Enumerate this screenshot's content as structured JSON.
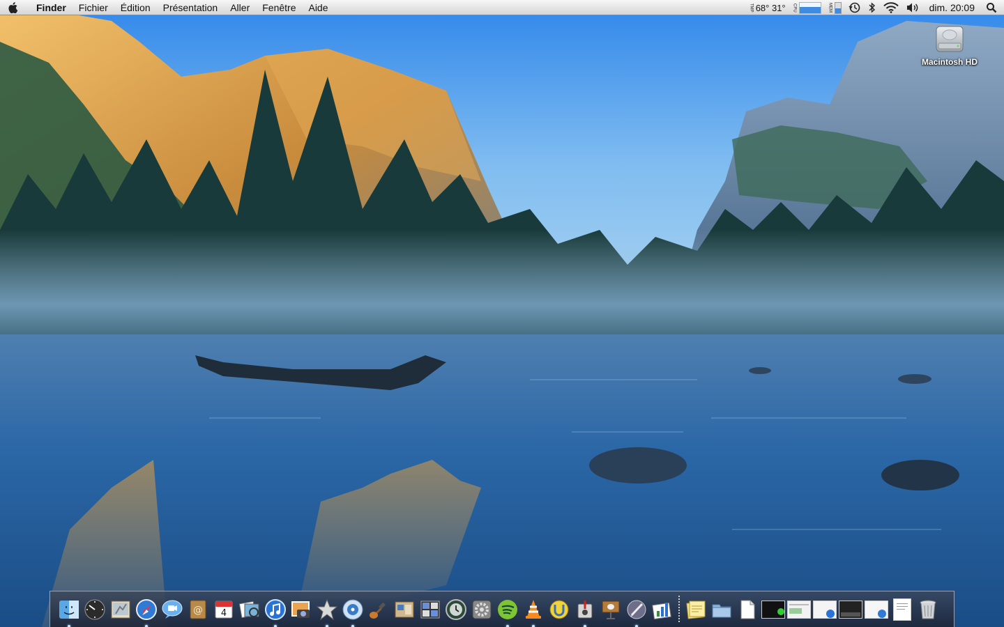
{
  "menubar": {
    "app_name": "Finder",
    "menus": [
      "Fichier",
      "Édition",
      "Présentation",
      "Aller",
      "Fenêtre",
      "Aide"
    ],
    "status": {
      "tmp_label": "TMP",
      "temperature": "68° 31°",
      "cpu_label": "CPU",
      "cpu_load": 0.6,
      "mem_label": "MEM",
      "mem_used": 0.45,
      "clock": "dim. 20:09"
    }
  },
  "desktop": {
    "icons": [
      {
        "label": "Macintosh HD",
        "icon": "hard-drive-icon"
      }
    ]
  },
  "dock": {
    "apps": [
      {
        "name": "finder-icon",
        "running": true
      },
      {
        "name": "dashboard-icon",
        "running": false
      },
      {
        "name": "mail-icon",
        "running": false
      },
      {
        "name": "safari-icon",
        "running": true
      },
      {
        "name": "ichat-icon",
        "running": false
      },
      {
        "name": "address-book-icon",
        "running": false
      },
      {
        "name": "ical-icon",
        "running": false,
        "text": "4"
      },
      {
        "name": "preview-icon",
        "running": false
      },
      {
        "name": "itunes-icon",
        "running": true
      },
      {
        "name": "iphoto-icon",
        "running": false
      },
      {
        "name": "imovie-icon",
        "running": true
      },
      {
        "name": "idvd-icon",
        "running": true
      },
      {
        "name": "garageband-icon",
        "running": false
      },
      {
        "name": "iweb-icon",
        "running": false
      },
      {
        "name": "spaces-icon",
        "running": false
      },
      {
        "name": "time-machine-icon",
        "running": false
      },
      {
        "name": "system-preferences-icon",
        "running": false
      },
      {
        "name": "spotify-icon",
        "running": true
      },
      {
        "name": "vlc-icon",
        "running": true
      },
      {
        "name": "utorrent-icon",
        "running": false
      },
      {
        "name": "instruments-icon",
        "running": true
      },
      {
        "name": "keynote-icon",
        "running": false
      },
      {
        "name": "script-editor-icon",
        "running": true
      },
      {
        "name": "numbers-icon",
        "running": false
      }
    ],
    "stacks": [
      {
        "name": "notes-stack-icon"
      },
      {
        "name": "folder-stack-icon"
      },
      {
        "name": "document-stack-icon"
      },
      {
        "name": "terminal-window-thumb"
      },
      {
        "name": "window-thumb-1"
      },
      {
        "name": "window-thumb-2"
      },
      {
        "name": "window-thumb-3"
      },
      {
        "name": "window-thumb-4"
      },
      {
        "name": "document-window-thumb"
      },
      {
        "name": "trash-icon"
      }
    ]
  }
}
